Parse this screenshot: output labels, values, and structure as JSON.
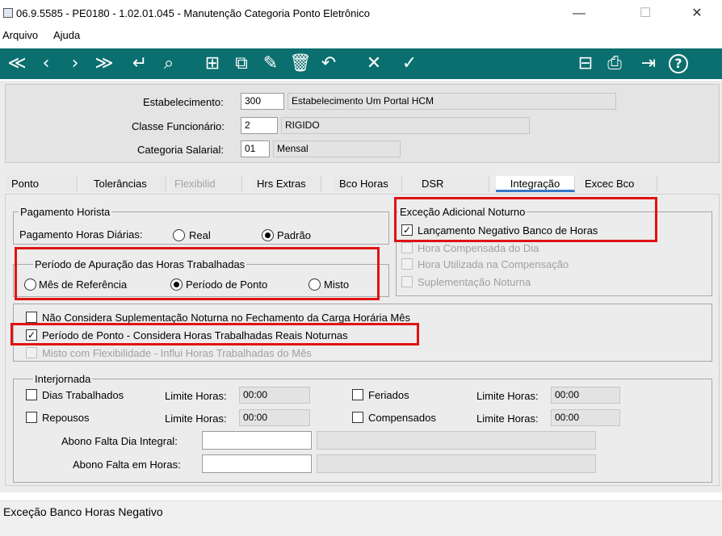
{
  "window": {
    "title": "06.9.5585 - PE0180 - 1.02.01.045 - Manutenção Categoria Ponto Eletrônico",
    "minimize": "—",
    "maximize": "☐",
    "close": "✕"
  },
  "menu": [
    "Arquivo",
    "Ajuda"
  ],
  "toolbar": {
    "left_icons": [
      "first-icon",
      "prev-icon",
      "next-icon",
      "last-icon",
      "goto-icon",
      "search-icon",
      "new-icon",
      "copy-icon",
      "edit-icon",
      "delete-icon",
      "undo-icon",
      "cancel-icon",
      "confirm-icon"
    ],
    "right_icons": [
      "hierarchy-icon",
      "print-icon",
      "exit-icon",
      "help-icon"
    ],
    "glyphs": {
      "first": "≪",
      "prev": "‹",
      "next": "›",
      "last": "≫",
      "goto": "↵",
      "search": "⌕",
      "new": "⊞",
      "copy": "⧉",
      "edit": "✎",
      "delete": "🗑",
      "undo": "↶",
      "cancel": "✕",
      "confirm": "✓",
      "hierarchy": "⊟",
      "print": "⎙",
      "exit": "⇥",
      "help": "?"
    },
    "color": "#0b6f6f"
  },
  "header": {
    "estabelecimento_label": "Estabelecimento:",
    "estabelecimento_code": "300",
    "estabelecimento_name": "Estabelecimento Um Portal HCM",
    "classe_label": "Classe Funcionário:",
    "classe_code": "2",
    "classe_name": "RIGIDO",
    "categoria_label": "Categoria Salarial:",
    "categoria_code": "01",
    "categoria_name": "Mensal"
  },
  "tabs": [
    {
      "label": "Ponto",
      "state": "normal"
    },
    {
      "label": "Tolerâncias",
      "state": "normal"
    },
    {
      "label": "Flexibilid",
      "state": "disabled"
    },
    {
      "label": "Hrs Extras",
      "state": "normal"
    },
    {
      "label": "Bco Horas",
      "state": "normal"
    },
    {
      "label": "DSR",
      "state": "normal"
    },
    {
      "label": "Integração",
      "state": "active"
    },
    {
      "label": "Excec Bco",
      "state": "normal"
    }
  ],
  "pagamento": {
    "legend": "Pagamento Horista",
    "label": "Pagamento Horas Diárias:",
    "opt_real": "Real",
    "opt_padrao": "Padrão",
    "selected": "Padrão"
  },
  "periodo": {
    "legend": "Período de Apuração das Horas Trabalhadas",
    "opt_mes": "Mês de Referência",
    "opt_ponto": "Período de Ponto",
    "opt_misto": "Misto",
    "selected": "Período de Ponto"
  },
  "excecao": {
    "legend": "Exceção Adicional Noturno",
    "items": [
      {
        "label": "Lançamento Negativo Banco de Horas",
        "checked": true,
        "enabled": true
      },
      {
        "label": "Hora Compensada do Dia",
        "checked": false,
        "enabled": false
      },
      {
        "label": "Hora Utilizada na Compensação",
        "checked": false,
        "enabled": false
      },
      {
        "label": "Suplementação Noturna",
        "checked": false,
        "enabled": false
      }
    ]
  },
  "opcoes": {
    "nao_considera": "Não Considera Suplementação Noturna no Fechamento da Carga Horária Mês",
    "nao_considera_checked": false,
    "periodo_ponto": "Período de Ponto - Considera Horas Trabalhadas Reais Noturnas",
    "periodo_ponto_checked": true,
    "misto_flex": "Misto com Flexibilidade - Influi Horas Trabalhadas do Mês",
    "misto_flex_checked": false
  },
  "interjornada": {
    "legend": "Interjornada",
    "dias_trabalhados": "Dias Trabalhados",
    "repousos": "Repousos",
    "feriados": "Feriados",
    "compensados": "Compensados",
    "limite_label": "Limite Horas:",
    "limite_dias": "00:00",
    "limite_repousos": "00:00",
    "limite_feriados": "00:00",
    "limite_compensados": "00:00",
    "abono_integral_label": "Abono Falta Dia Integral:",
    "abono_integral_value": "",
    "abono_horas_label": "Abono Falta em Horas:",
    "abono_horas_value": ""
  },
  "status": {
    "text": "Exceção Banco Horas Negativo"
  },
  "highlight_color": "#e01313"
}
